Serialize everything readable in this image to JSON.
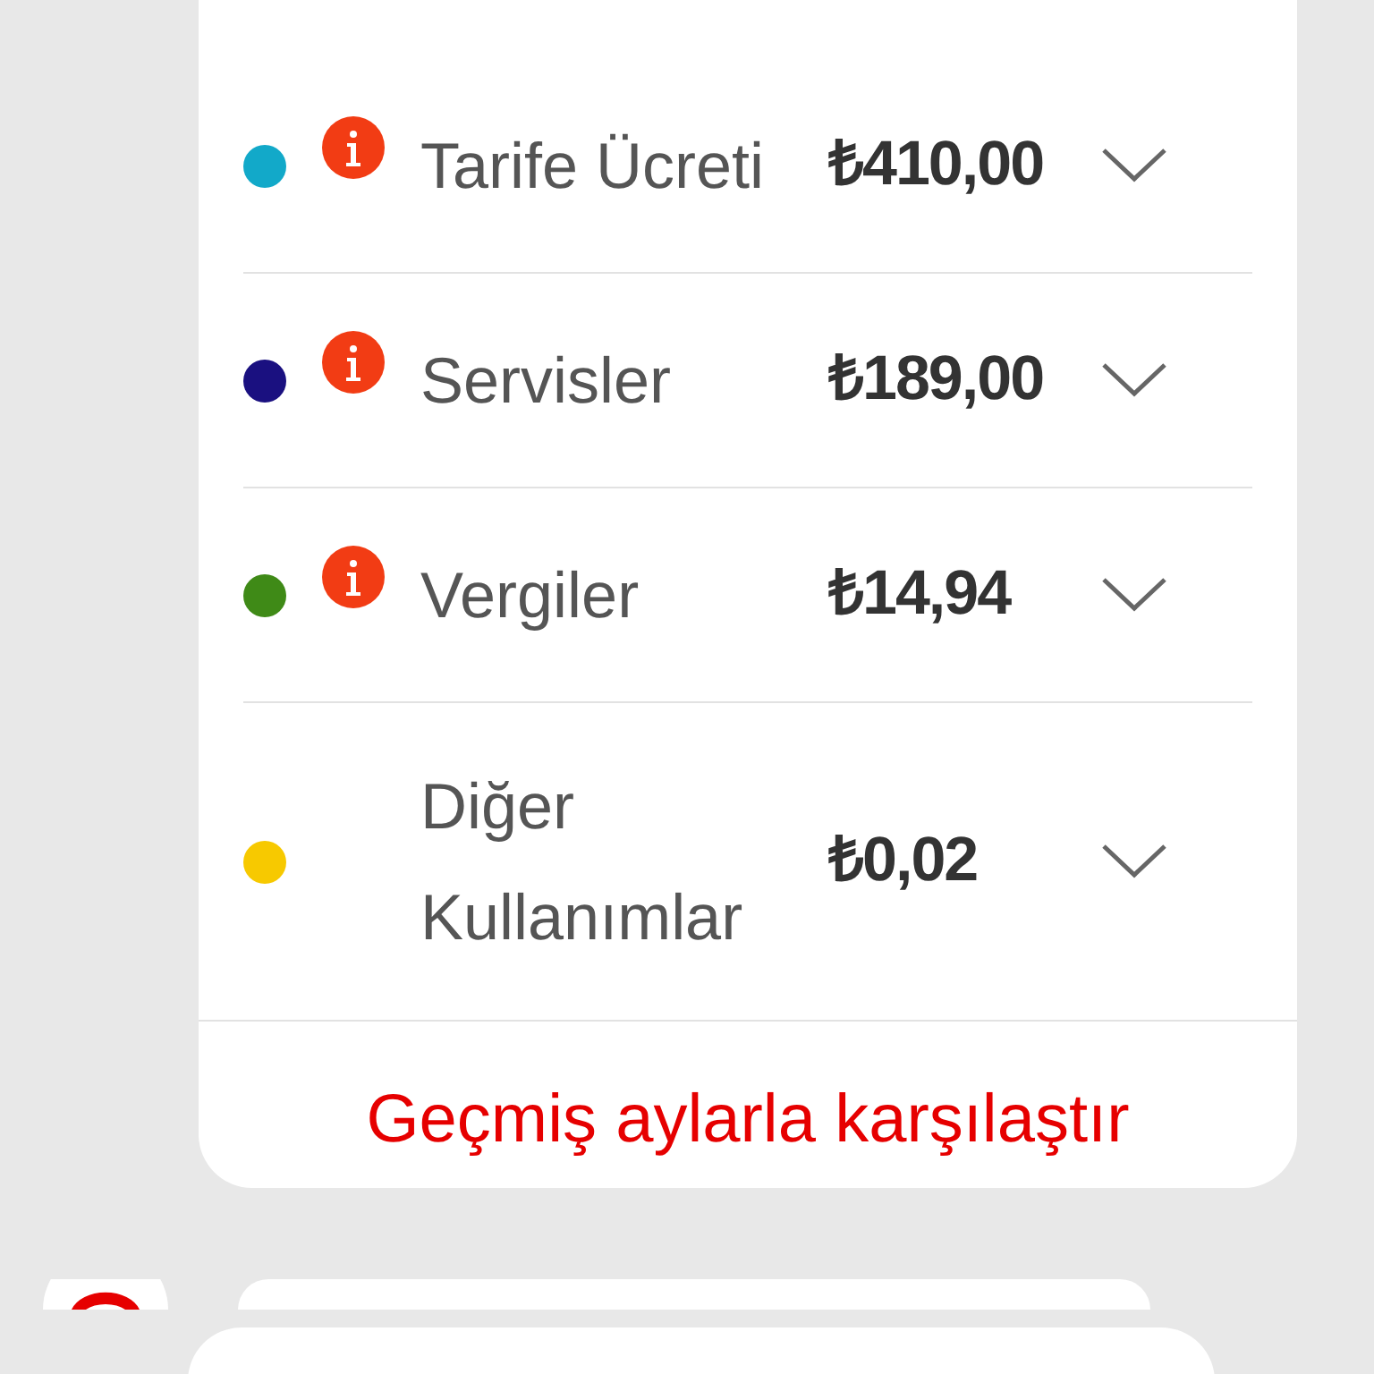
{
  "breakdown": [
    {
      "label": "Tarife Ücreti",
      "amount": "₺410,00",
      "color": "#12a9c9",
      "info": true,
      "expanded": false
    },
    {
      "label": "Servisler",
      "amount": "₺189,00",
      "color": "#1a1080",
      "info": true,
      "expanded": false
    },
    {
      "label": "Vergiler",
      "amount": "₺14,94",
      "color": "#3f8a17",
      "info": true,
      "expanded": false
    },
    {
      "label": "Diğer Kullanımlar",
      "amount": "₺0,02",
      "color": "#f7c900",
      "info": false,
      "expanded": false
    }
  ],
  "compare_link": "Geçmiş aylarla karşılaştır"
}
